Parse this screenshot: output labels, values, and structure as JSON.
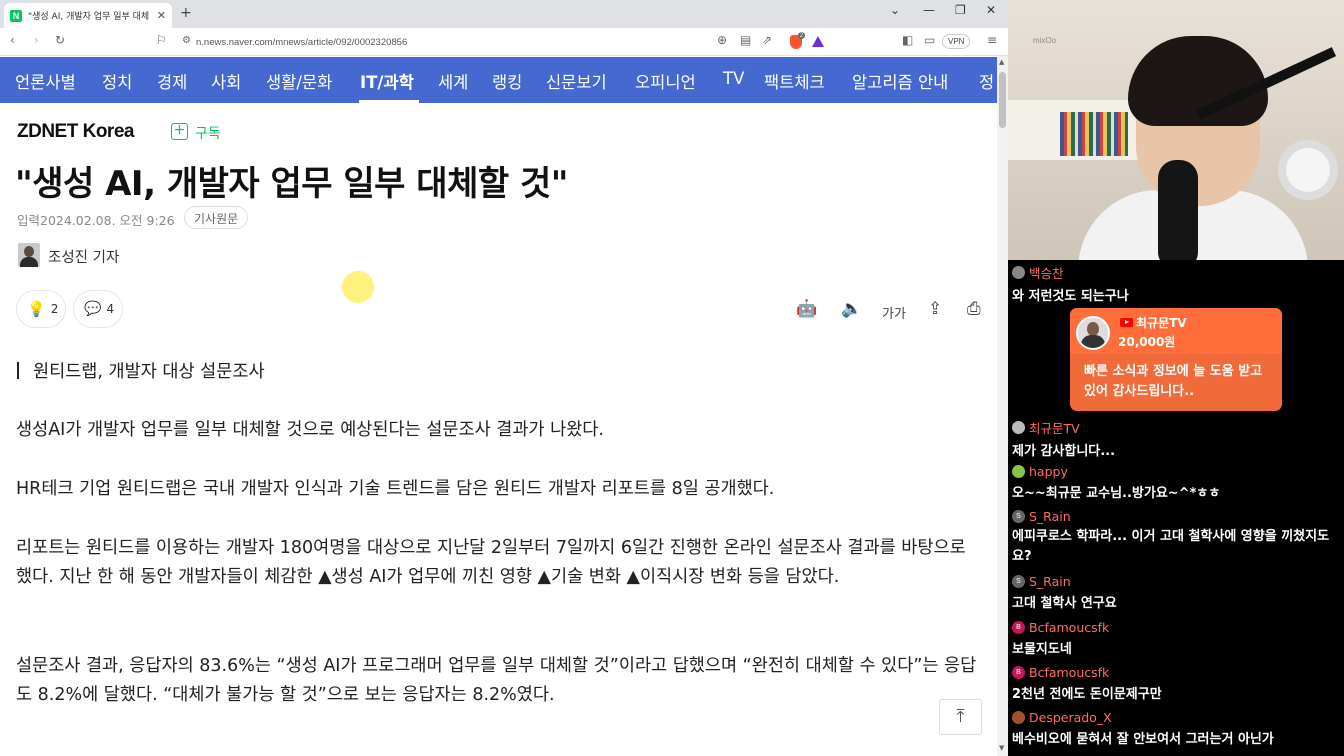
{
  "browser": {
    "tab_title": "\"생성 AI, 개발자 업무 일부 대체",
    "favicon_letter": "N",
    "url": "n.news.naver.com/mnews/article/092/0002320856",
    "vpn_label": "VPN",
    "brave_badge": "2"
  },
  "nav": {
    "items": [
      "언론사별",
      "정치",
      "경제",
      "사회",
      "생활/문화",
      "IT/과학",
      "세계",
      "랭킹",
      "신문보기",
      "오피니언",
      "TV",
      "팩트체크",
      "알고리즘 안내",
      "정"
    ],
    "active": "IT/과학"
  },
  "article": {
    "press": "ZDNET Korea",
    "subscribe": "구독",
    "headline": "\"생성 AI, 개발자 업무 일부 대체할 것\"",
    "date": "입력2024.02.08. 오전 9:26",
    "original_button": "기사원문",
    "reporter": "조성진 기자",
    "reaction_count": "2",
    "comment_count": "4",
    "font_size_label": "가가",
    "subheading": "원티드랩, 개발자 대상 설문조사",
    "paragraphs": [
      "생성AI가 개발자 업무를 일부 대체할 것으로 예상된다는 설문조사 결과가 나왔다.",
      "HR테크 기업 원티드랩은 국내 개발자 인식과 기술 트렌드를 담은 원티드 개발자 리포트를 8일 공개했다.",
      "리포트는 원티드를 이용하는 개발자 180여명을 대상으로 지난달 2일부터 7일까지 6일간 진행한 온라인 설문조사 결과를 바탕으로 했다. 지난 한 해 동안 개발자들이 체감한 ▲생성 AI가 업무에 끼친 영향 ▲기술 변화 ▲이직시장 변화 등을 담았다.",
      "설문조사 결과, 응답자의 83.6%는 “생성 AI가 프로그래머 업무를 일부 대체할 것”이라고 답했으며 “완전히 대체할 수 있다”는 응답도 8.2%에 달했다. “대체가 불가능 할 것”으로 보는 응답자는 8.2%였다."
    ]
  },
  "stream": {
    "webcam_wall_text": "mixOo",
    "chat": [
      {
        "user": "백승찬",
        "user_color": "#ff6b6b",
        "avatar_color": "#888",
        "text": "와 저런것도 되는구나"
      },
      {
        "user": "최규문TV",
        "user_color": "#ff6b6b",
        "avatar_color": "#bbb",
        "text": "제가 감사합니다..."
      },
      {
        "user": "happy",
        "user_color": "#ff6b6b",
        "avatar_color": "#8bc34a",
        "text": "오~~최규문 교수님..방가요~^*ㅎㅎ"
      },
      {
        "user": "S_Rain",
        "user_color": "#ff6b6b",
        "avatar_color": "#666",
        "avatar_letter": "S",
        "text": "에피쿠로스 학파라... 이거 고대 철학사에 영향을 끼쳤지도요?"
      },
      {
        "user": "S_Rain",
        "user_color": "#ff6b6b",
        "avatar_color": "#666",
        "avatar_letter": "S",
        "text": "고대 철학사 연구요"
      },
      {
        "user": "Bcfamoucsfk",
        "user_color": "#ff6b6b",
        "avatar_color": "#c2185b",
        "avatar_letter": "B",
        "text": "보물지도네"
      },
      {
        "user": "Bcfamoucsfk",
        "user_color": "#ff6b6b",
        "avatar_color": "#c2185b",
        "avatar_letter": "B",
        "text": "2천년 전에도 돈이문제구만"
      },
      {
        "user": "Desperado_X",
        "user_color": "#ff6b6b",
        "avatar_color": "#a0522d",
        "text": "베수비오에 묻혀서 잘 안보여서 그러는거 아닌가"
      }
    ],
    "donation": {
      "name": "최규문TV",
      "amount": "20,000원",
      "message": "빠른 소식과 정보에 늘 도움 받고 있어 감사드립니다.."
    }
  }
}
